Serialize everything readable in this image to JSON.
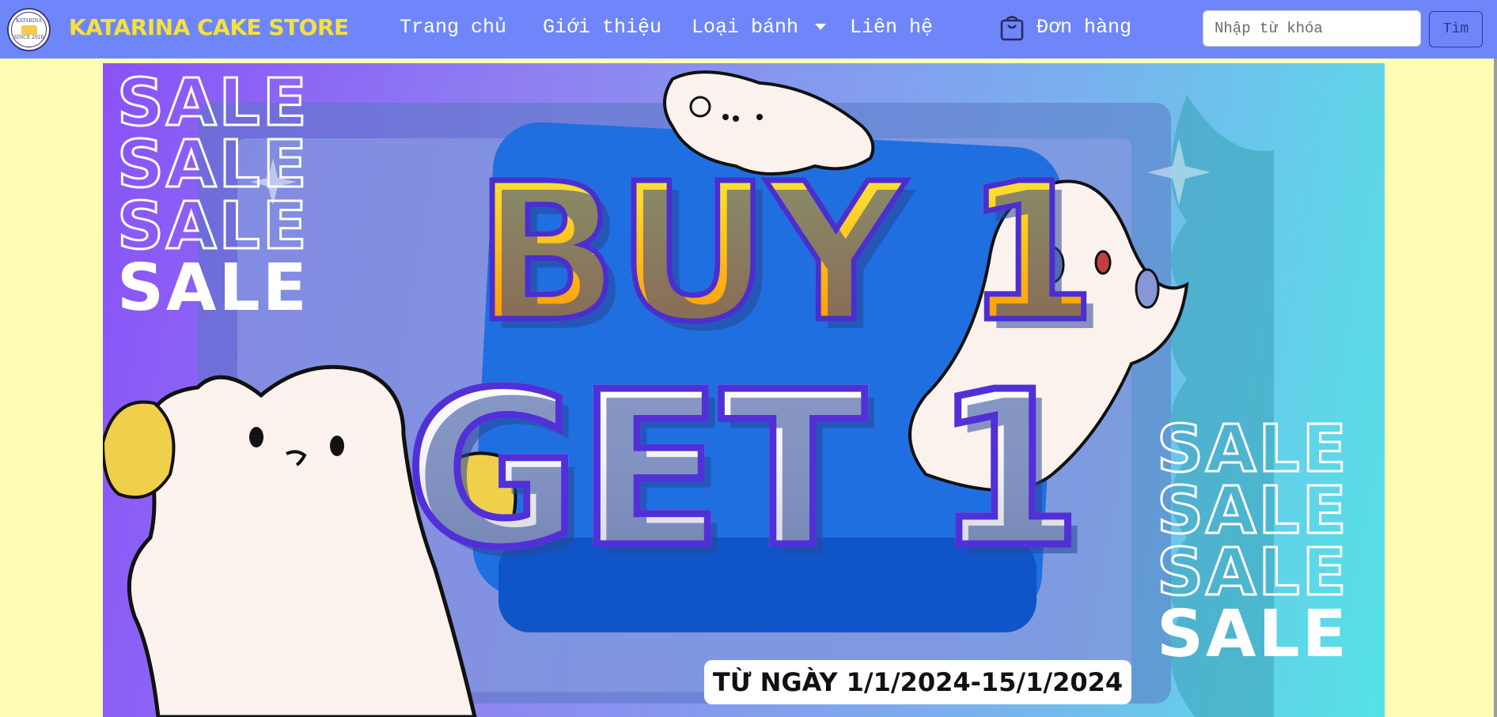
{
  "brand": {
    "name": "KATARINA CAKE STORE",
    "logo_top_text": "KATARINA",
    "logo_bottom_text": "SINCE 2020",
    "name_color": "#f5e13b"
  },
  "nav": {
    "items": [
      {
        "label": "Trang chủ"
      },
      {
        "label": "Giới thiệu"
      },
      {
        "label": "Loại bánh"
      },
      {
        "label": "Liên hệ"
      }
    ],
    "orders": {
      "label": "Đơn hàng",
      "icon": "shopping-bag-icon"
    }
  },
  "search": {
    "placeholder": "Nhập từ khóa",
    "value": "",
    "button_label": "Tìm"
  },
  "colors": {
    "navbar": "#6f86fb",
    "page_background": "#fdfdb4"
  },
  "banner": {
    "sale_word": "SALE",
    "headline_line1": "BUY 1",
    "headline_line2": "GET 1",
    "date_text": "TỪ NGÀY 1/1/2024-15/1/2024"
  }
}
